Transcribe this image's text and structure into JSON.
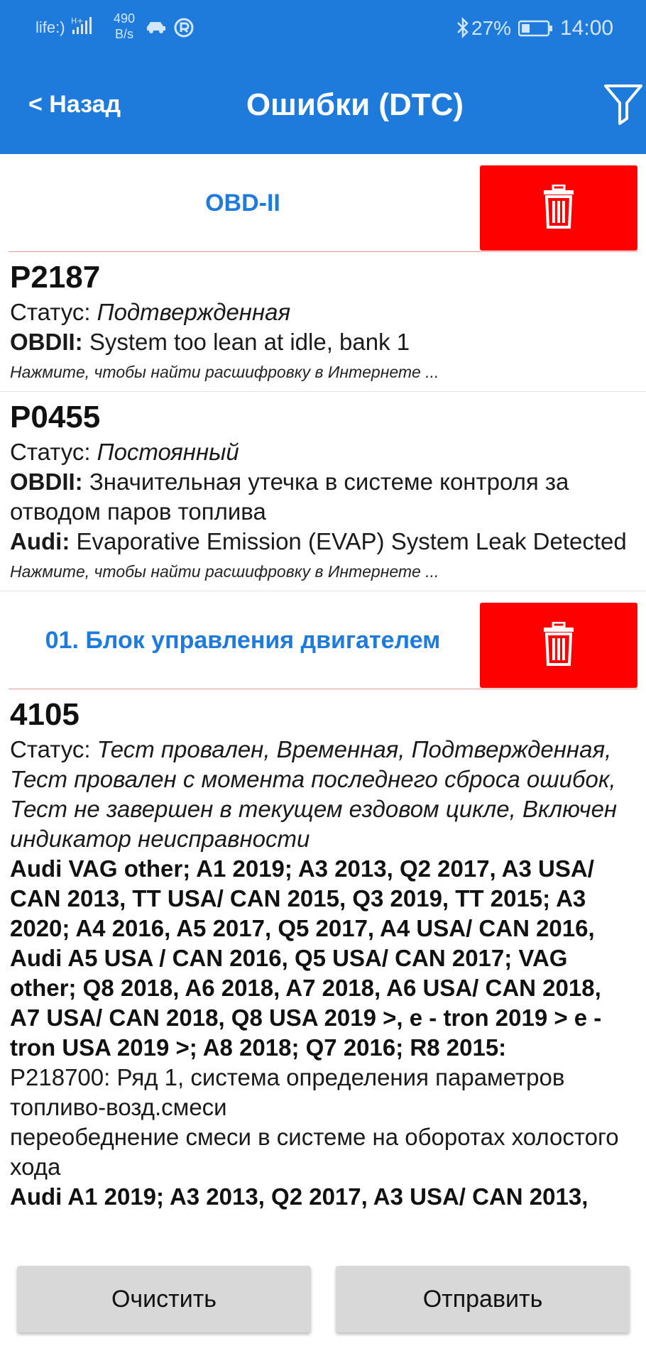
{
  "status_bar": {
    "carrier": "life:)",
    "net_type": "H+",
    "speed_value": "490",
    "speed_unit": "B/s",
    "battery": "27%",
    "time": "14:00",
    "icons": [
      "signal-icon",
      "car-icon",
      "r-icon",
      "bluetooth-icon",
      "battery-icon"
    ]
  },
  "app_bar": {
    "back": "< Назад",
    "title": "Ошибки (DTC)",
    "filter_icon": "filter-icon"
  },
  "groups": [
    {
      "title": "OBD-II",
      "delete_icon": "trash-icon",
      "delete_color": "#fe0000",
      "dtcs": [
        {
          "code": "P2187",
          "status_label": "Статус:",
          "status_value": "Подтвержденная",
          "desc_label": "OBDII:",
          "desc_value": "System too lean at idle, bank 1",
          "hint": "Нажмите, чтобы найти расшифровку в Интернете ..."
        },
        {
          "code": "P0455",
          "status_label": "Статус:",
          "status_value": "Постоянный",
          "desc_label": "OBDII:",
          "desc_value": "Значительная утечка в системе контроля за отводом паров топлива",
          "extra_label": "Audi:",
          "extra_value": "Evaporative Emission (EVAP) System Leak Detected",
          "hint": "Нажмите, чтобы найти расшифровку в Интернете ..."
        }
      ]
    },
    {
      "title": "01. Блок управления двигателем",
      "delete_icon": "trash-icon",
      "dtcs": [
        {
          "code": "4105",
          "status_label": "Статус:",
          "status_value": "Тест провален, Временная, Подтвержденная, Тест провален с момента последнего сброса ошибок, Тест не завершен в текущем ездовом цикле, Включен индикатор неисправности",
          "models": "Audi VAG other; A1 2019; A3 2013, Q2 2017, A3 USA/ CAN 2013, TT USA/ CAN 2015, Q3 2019, TT 2015; A3 2020; A4 2016, A5 2017, Q5 2017, A4 USA/ CAN 2016, Audi A5 USA / CAN 2016, Q5 USA/ CAN 2017; VAG other; Q8 2018, A6 2018, A7 2018, A6 USA/ CAN 2018, A7 USA/ CAN 2018, Q8 USA 2019 >, e - tron 2019 > e - tron USA 2019 >; A8 2018; Q7 2016; R8 2015:",
          "detail_1": "P218700: Ряд 1, система определения параметров топливо-возд.смеси",
          "detail_2": "переобеднение смеси в системе на оборотах холостого хода",
          "models_2": "Audi A1 2019; A3 2013, Q2 2017, A3 USA/ CAN 2013,"
        }
      ]
    }
  ],
  "buttons": {
    "clear": "Очистить",
    "send": "Отправить"
  },
  "colors": {
    "primary": "#1e7bdc",
    "delete": "#fe0000",
    "button_bg": "#d8d8d8"
  }
}
